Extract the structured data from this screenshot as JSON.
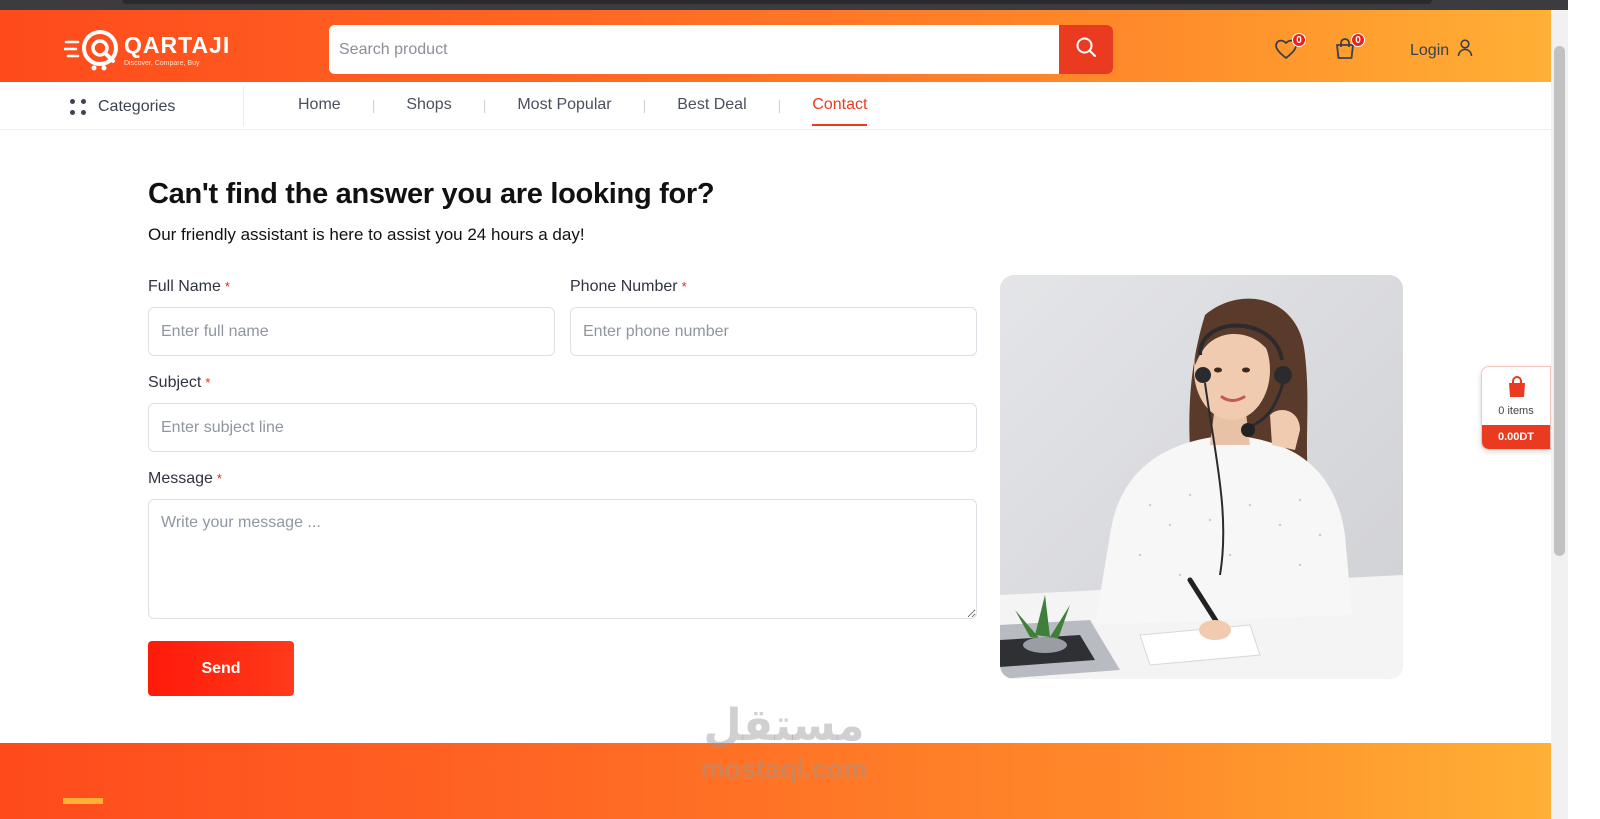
{
  "header": {
    "logo_name": "QARTAJI",
    "logo_tagline": "Discover, Compare, Buy",
    "search_placeholder": "Search product",
    "wishlist_count": "0",
    "cart_count": "0",
    "login_label": "Login"
  },
  "nav": {
    "categories_label": "Categories",
    "links": [
      "Home",
      "Shops",
      "Most Popular",
      "Best Deal",
      "Contact"
    ],
    "active": "Contact"
  },
  "contact": {
    "title": "Can't find the answer you are looking for?",
    "subtitle": "Our friendly assistant is here to assist you 24 hours a day!",
    "fields": {
      "full_name": {
        "label": "Full Name",
        "placeholder": "Enter full name"
      },
      "phone": {
        "label": "Phone Number",
        "placeholder": "Enter phone number"
      },
      "subject": {
        "label": "Subject",
        "placeholder": "Enter subject line"
      },
      "message": {
        "label": "Message",
        "placeholder": "Write your message ..."
      }
    },
    "required_mark": "*",
    "send_label": "Send"
  },
  "cart_widget": {
    "items_label": "0 items",
    "total": "0.00DT"
  },
  "watermark": {
    "arabic": "مستقل",
    "latin": "mostaql.com"
  },
  "colors": {
    "accent": "#ea3a1f",
    "header_gradient_start": "#ff4a1c",
    "header_gradient_end": "#ffb035"
  },
  "icons": {
    "search": "search-icon",
    "wishlist": "heart-icon",
    "cart": "shopping-bag-icon",
    "user": "user-icon",
    "categories": "grid-dots-icon"
  }
}
